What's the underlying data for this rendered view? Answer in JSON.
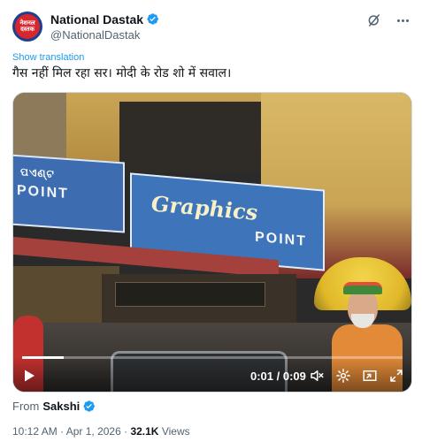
{
  "author": {
    "display_name": "National Dastak",
    "handle": "@NationalDastak",
    "avatar_text": "नेशनल दस्तक"
  },
  "tweet": {
    "show_translation": "Show translation",
    "text": "गैस नहीं मिल रहा सर। मोदी के रोड शो में सवाल।"
  },
  "video": {
    "time_display": "0:01 / 0:09",
    "progress_fraction": 0.11,
    "scene_signs": {
      "left_top": "ପଏଣ୍ଟ",
      "left_bottom": "POINT",
      "main_top": "Graphics",
      "main_bottom": "POINT"
    }
  },
  "attribution": {
    "from_label": "From",
    "source": "Sakshi"
  },
  "meta": {
    "time": "10:12 AM",
    "separator1": "·",
    "date": "Apr 1, 2026",
    "separator2": "·",
    "views_count": "32.1K",
    "views_label": "Views"
  },
  "colors": {
    "link": "#1d9bf0",
    "secondary_text": "#536471",
    "primary_text": "#0f1419"
  }
}
